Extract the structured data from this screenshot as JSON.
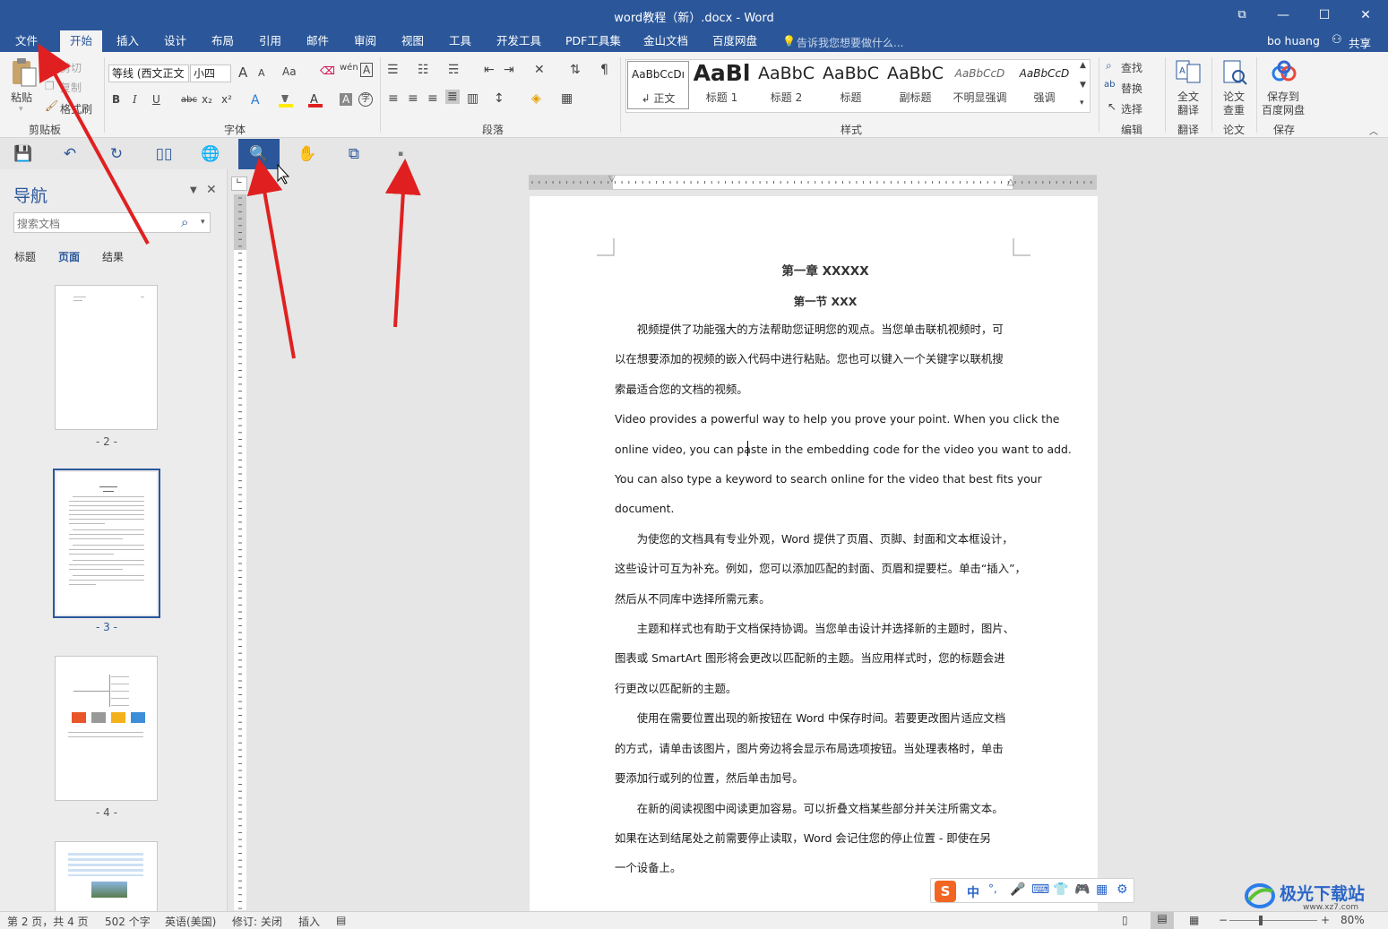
{
  "window": {
    "title": "word教程（新）.docx - Word",
    "restore_glyph": "⧉",
    "minimize_glyph": "—",
    "maximize_glyph": "☐",
    "close_glyph": "✕"
  },
  "tabs": [
    "文件",
    "开始",
    "插入",
    "设计",
    "布局",
    "引用",
    "邮件",
    "审阅",
    "视图",
    "工具",
    "开发工具",
    "PDF工具集",
    "金山文档",
    "百度网盘"
  ],
  "active_tab": "开始",
  "tellme": "告诉我您想要做什么...",
  "user": "bo huang",
  "share": "共享",
  "clipboard": {
    "paste": "粘贴",
    "cut": "剪切",
    "copy": "复制",
    "format_painter": "格式刷",
    "group": "剪贴板"
  },
  "font": {
    "name": "等线 (西文正文",
    "size": "小四",
    "group": "字体",
    "case_btn": "Aa",
    "grow": "A",
    "shrink": "A"
  },
  "paragraph": {
    "group": "段落"
  },
  "styles": {
    "group": "样式",
    "items": [
      {
        "preview": "AaBbCcDı",
        "name": "↲ 正文"
      },
      {
        "preview": "AaBl",
        "name": "标题 1"
      },
      {
        "preview": "AaBbC",
        "name": "标题 2"
      },
      {
        "preview": "AaBbC",
        "name": "标题"
      },
      {
        "preview": "AaBbC",
        "name": "副标题"
      },
      {
        "preview": "AaBbCcD",
        "name": "不明显强调"
      },
      {
        "preview": "AaBbCcD",
        "name": "强调"
      }
    ]
  },
  "editing": {
    "find": "查找",
    "replace": "替换",
    "select": "选择",
    "group": "编辑"
  },
  "translate": {
    "full": "全文",
    "full2": "翻译",
    "group": "翻译"
  },
  "paper": {
    "label": "论文",
    "label2": "查重",
    "group": "论文"
  },
  "save_cloud": {
    "label": "保存到",
    "label2": "百度网盘",
    "group": "保存"
  },
  "navigation": {
    "title": "导航",
    "search_placeholder": "搜索文档",
    "tabs": [
      "标题",
      "页面",
      "结果"
    ],
    "active_tab": "页面",
    "page_labels": [
      "- 2 -",
      "- 3 -",
      "- 4 -"
    ]
  },
  "document": {
    "heading1": "第一章  XXXXX",
    "heading2": "第一节  XXX",
    "lines": [
      "　　视频提供了功能强大的方法帮助您证明您的观点。当您单击联机视频时，可",
      "以在想要添加的视频的嵌入代码中进行粘贴。您也可以键入一个关键字以联机搜",
      "索最适合您的文档的视频。",
      "Video provides a powerful way to help you prove your point. When you click the",
      "online video, you can paste in the embedding code for the video you want to add.",
      "You can also type a keyword to search online for the video that best fits your",
      "document.",
      "　　为使您的文档具有专业外观，Word 提供了页眉、页脚、封面和文本框设计，",
      "这些设计可互为补充。例如，您可以添加匹配的封面、页眉和提要栏。单击“插入”，",
      "然后从不同库中选择所需元素。",
      "　　主题和样式也有助于文档保持协调。当您单击设计并选择新的主题时，图片、",
      "图表或 SmartArt 图形将会更改以匹配新的主题。当应用样式时，您的标题会进",
      "行更改以匹配新的主题。",
      "　　使用在需要位置出现的新按钮在 Word 中保存时间。若要更改图片适应文档",
      "的方式，请单击该图片，图片旁边将会显示布局选项按钮。当处理表格时，单击",
      "要添加行或列的位置，然后单击加号。",
      "　　在新的阅读视图中阅读更加容易。可以折叠文档某些部分并关注所需文本。",
      "如果在达到结尾处之前需要停止读取，Word 会记住您的停止位置 - 即使在另",
      "一个设备上。"
    ]
  },
  "status": {
    "page": "第 2 页，共 4 页",
    "words": "502 个字",
    "lang": "英语(美国)",
    "track": "修订: 关闭",
    "mode": "插入",
    "zoom": "80%"
  },
  "ime": {
    "lang": "中",
    "punct": "°,"
  },
  "watermark": {
    "text": "极光下载站",
    "url": "www.xz7.com"
  },
  "colors": {
    "brand": "#2b579a",
    "arrow": "#e02020"
  }
}
